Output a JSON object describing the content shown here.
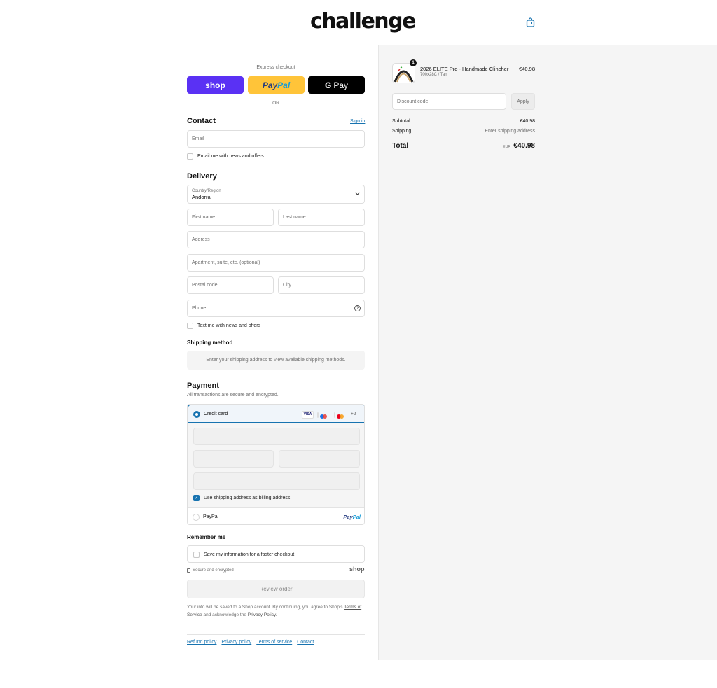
{
  "header": {
    "logo_text": "challenge",
    "cart_icon": "shopping-bag-icon"
  },
  "express": {
    "label": "Express checkout",
    "shop_label": "shop",
    "paypal_label_a": "Pay",
    "paypal_label_b": "Pal",
    "gpay_label": "Pay",
    "gpay_g": "G",
    "or_label": "OR"
  },
  "contact": {
    "title": "Contact",
    "sign_in": "Sign in",
    "email_placeholder": "Email",
    "news_checkbox": "Email me with news and offers"
  },
  "delivery": {
    "title": "Delivery",
    "country_label": "Country/Region",
    "country_value": "Andorra",
    "first_name": "First name",
    "last_name": "Last name",
    "address": "Address",
    "apartment": "Apartment, suite, etc. (optional)",
    "postal_code": "Postal code",
    "city": "City",
    "phone": "Phone",
    "help_glyph": "?",
    "text_checkbox": "Text me with news and offers"
  },
  "shipping": {
    "title": "Shipping method",
    "message": "Enter your shipping address to view available shipping methods."
  },
  "payment": {
    "title": "Payment",
    "subtitle": "All transactions are secure and encrypted.",
    "credit_card_label": "Credit card",
    "visa": "VISA",
    "more_cards": "+2",
    "billing_checkbox": "Use shipping address as billing address",
    "billing_check_glyph": "✓",
    "paypal_label": "PayPal",
    "paypal_logo_a": "Pay",
    "paypal_logo_b": "Pal"
  },
  "remember": {
    "title": "Remember me",
    "checkbox": "Save my information for a faster checkout",
    "secure_text": "Secure and encrypted",
    "shop_mark": "shop"
  },
  "review_button": "Review order",
  "legal": {
    "text_before": "Your info will be saved to a Shop account. By continuing, you agree to Shop's ",
    "terms": "Terms of Service",
    "text_middle": " and acknowledge the ",
    "privacy": "Privacy Policy",
    "text_after": "."
  },
  "footer_links": [
    "Refund policy",
    "Privacy policy",
    "Terms of service",
    "Contact"
  ],
  "order": {
    "quantity": "1",
    "product_name": "2026 ELITE Pro - Handmade Clincher",
    "product_variant": "700x28C / Tan",
    "product_price": "€40.98",
    "discount_placeholder": "Discount code",
    "apply_label": "Apply",
    "subtotal_label": "Subtotal",
    "subtotal_value": "€40.98",
    "shipping_label": "Shipping",
    "shipping_value": "Enter shipping address",
    "total_label": "Total",
    "currency": "EUR",
    "total_value": "€40.98"
  },
  "colors": {
    "accent": "#1773b0",
    "shop_purple": "#5a31f4",
    "paypal_yellow": "#ffc439",
    "gpay_black": "#000000"
  }
}
